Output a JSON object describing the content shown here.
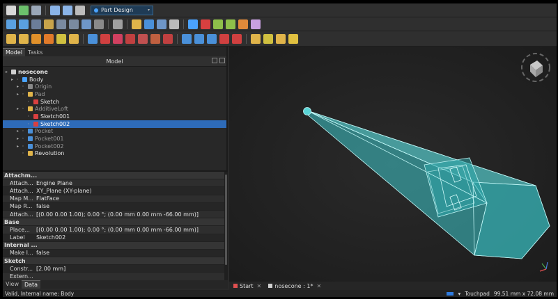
{
  "toolbar": {
    "workbench": "Part Design"
  },
  "model_panel": {
    "tabs": [
      "Model",
      "Tasks"
    ],
    "header": "Model",
    "tree": [
      {
        "label": "nosecone",
        "bold": true,
        "indent": 0,
        "icon_color": "#cfcfcf"
      },
      {
        "label": "Body",
        "indent": 1,
        "icon_color": "#4aa3ff"
      },
      {
        "label": "Origin",
        "indent": 2,
        "dim": true,
        "icon_color": "#888888"
      },
      {
        "label": "Pad",
        "indent": 2,
        "dim": true,
        "icon_color": "#e0b44a"
      },
      {
        "label": "Sketch",
        "indent": 3,
        "icon_color": "#d94040"
      },
      {
        "label": "AdditiveLoft",
        "indent": 2,
        "dim": true,
        "icon_color": "#e0b44a"
      },
      {
        "label": "Sketch001",
        "indent": 3,
        "icon_color": "#d94040"
      },
      {
        "label": "Sketch002",
        "indent": 3,
        "selected": true,
        "icon_color": "#d94040"
      },
      {
        "label": "Pocket",
        "indent": 2,
        "dim": true,
        "icon_color": "#4a90d9"
      },
      {
        "label": "Pocket001",
        "indent": 2,
        "dim": true,
        "icon_color": "#4a90d9"
      },
      {
        "label": "Pocket002",
        "indent": 2,
        "dim": true,
        "icon_color": "#4a90d9"
      },
      {
        "label": "Revolution",
        "indent": 2,
        "icon_color": "#e0b44a"
      }
    ]
  },
  "properties": [
    {
      "group": true,
      "key": "Attachm..."
    },
    {
      "key": "Attach...",
      "value": "Engine Plane"
    },
    {
      "key": "Attach...",
      "value": "XY_Plane (XY-plane)"
    },
    {
      "key": "Map M...",
      "value": "FlatFace"
    },
    {
      "key": "Map R...",
      "value": "false"
    },
    {
      "key": "Attach...",
      "value": "[(0.00 0.00 1.00); 0.00 °; (0.00 mm  0.00 mm  -66.00 mm)]"
    },
    {
      "group": true,
      "key": "Base"
    },
    {
      "key": "Place...",
      "value": "[(0.00 0.00 1.00); 0.00 °; (0.00 mm  0.00 mm  -66.00 mm)]"
    },
    {
      "key": "Label",
      "value": "Sketch002"
    },
    {
      "group": true,
      "key": "Internal ..."
    },
    {
      "key": "Make I...",
      "value": "false"
    },
    {
      "group": true,
      "key": "Sketch"
    },
    {
      "key": "Constr...",
      "value": "[2.00 mm]"
    },
    {
      "key": "Extern...",
      "value": ""
    }
  ],
  "property_tabs": [
    "View",
    "Data"
  ],
  "doc_tabs": [
    {
      "label": "Start"
    },
    {
      "label": "nosecone : 1*"
    }
  ],
  "status": {
    "message": "Valid, Internal name: Body",
    "navigation": "Touchpad",
    "dimensions": "99.51 mm x 72.08 mm"
  },
  "colors": {
    "accent": "#2e6bb8",
    "model": "#3ec9cc"
  }
}
